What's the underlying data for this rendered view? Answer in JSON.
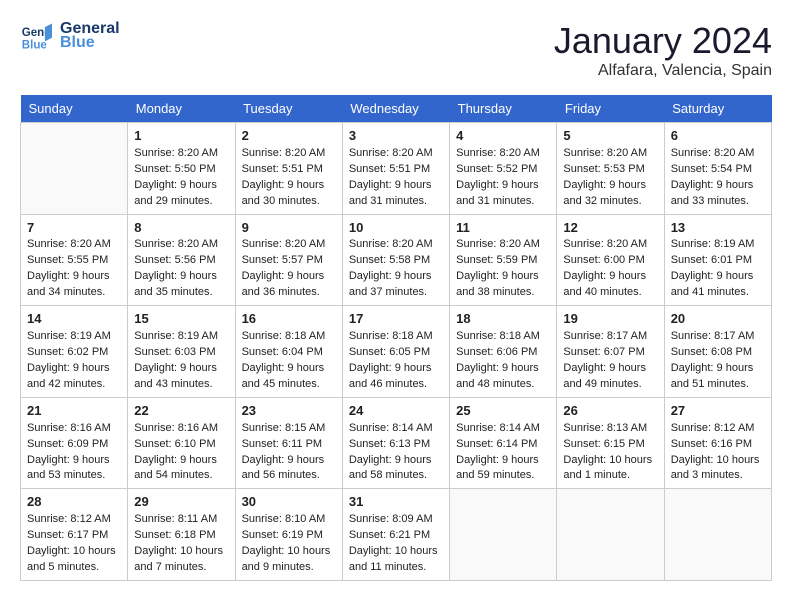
{
  "logo": {
    "line1": "General",
    "line2": "Blue"
  },
  "title": "January 2024",
  "location": "Alfafara, Valencia, Spain",
  "days_of_week": [
    "Sunday",
    "Monday",
    "Tuesday",
    "Wednesday",
    "Thursday",
    "Friday",
    "Saturday"
  ],
  "weeks": [
    [
      {
        "day": "",
        "sunrise": "",
        "sunset": "",
        "daylight": ""
      },
      {
        "day": "1",
        "sunrise": "Sunrise: 8:20 AM",
        "sunset": "Sunset: 5:50 PM",
        "daylight": "Daylight: 9 hours and 29 minutes."
      },
      {
        "day": "2",
        "sunrise": "Sunrise: 8:20 AM",
        "sunset": "Sunset: 5:51 PM",
        "daylight": "Daylight: 9 hours and 30 minutes."
      },
      {
        "day": "3",
        "sunrise": "Sunrise: 8:20 AM",
        "sunset": "Sunset: 5:51 PM",
        "daylight": "Daylight: 9 hours and 31 minutes."
      },
      {
        "day": "4",
        "sunrise": "Sunrise: 8:20 AM",
        "sunset": "Sunset: 5:52 PM",
        "daylight": "Daylight: 9 hours and 31 minutes."
      },
      {
        "day": "5",
        "sunrise": "Sunrise: 8:20 AM",
        "sunset": "Sunset: 5:53 PM",
        "daylight": "Daylight: 9 hours and 32 minutes."
      },
      {
        "day": "6",
        "sunrise": "Sunrise: 8:20 AM",
        "sunset": "Sunset: 5:54 PM",
        "daylight": "Daylight: 9 hours and 33 minutes."
      }
    ],
    [
      {
        "day": "7",
        "sunrise": "Sunrise: 8:20 AM",
        "sunset": "Sunset: 5:55 PM",
        "daylight": "Daylight: 9 hours and 34 minutes."
      },
      {
        "day": "8",
        "sunrise": "Sunrise: 8:20 AM",
        "sunset": "Sunset: 5:56 PM",
        "daylight": "Daylight: 9 hours and 35 minutes."
      },
      {
        "day": "9",
        "sunrise": "Sunrise: 8:20 AM",
        "sunset": "Sunset: 5:57 PM",
        "daylight": "Daylight: 9 hours and 36 minutes."
      },
      {
        "day": "10",
        "sunrise": "Sunrise: 8:20 AM",
        "sunset": "Sunset: 5:58 PM",
        "daylight": "Daylight: 9 hours and 37 minutes."
      },
      {
        "day": "11",
        "sunrise": "Sunrise: 8:20 AM",
        "sunset": "Sunset: 5:59 PM",
        "daylight": "Daylight: 9 hours and 38 minutes."
      },
      {
        "day": "12",
        "sunrise": "Sunrise: 8:20 AM",
        "sunset": "Sunset: 6:00 PM",
        "daylight": "Daylight: 9 hours and 40 minutes."
      },
      {
        "day": "13",
        "sunrise": "Sunrise: 8:19 AM",
        "sunset": "Sunset: 6:01 PM",
        "daylight": "Daylight: 9 hours and 41 minutes."
      }
    ],
    [
      {
        "day": "14",
        "sunrise": "Sunrise: 8:19 AM",
        "sunset": "Sunset: 6:02 PM",
        "daylight": "Daylight: 9 hours and 42 minutes."
      },
      {
        "day": "15",
        "sunrise": "Sunrise: 8:19 AM",
        "sunset": "Sunset: 6:03 PM",
        "daylight": "Daylight: 9 hours and 43 minutes."
      },
      {
        "day": "16",
        "sunrise": "Sunrise: 8:18 AM",
        "sunset": "Sunset: 6:04 PM",
        "daylight": "Daylight: 9 hours and 45 minutes."
      },
      {
        "day": "17",
        "sunrise": "Sunrise: 8:18 AM",
        "sunset": "Sunset: 6:05 PM",
        "daylight": "Daylight: 9 hours and 46 minutes."
      },
      {
        "day": "18",
        "sunrise": "Sunrise: 8:18 AM",
        "sunset": "Sunset: 6:06 PM",
        "daylight": "Daylight: 9 hours and 48 minutes."
      },
      {
        "day": "19",
        "sunrise": "Sunrise: 8:17 AM",
        "sunset": "Sunset: 6:07 PM",
        "daylight": "Daylight: 9 hours and 49 minutes."
      },
      {
        "day": "20",
        "sunrise": "Sunrise: 8:17 AM",
        "sunset": "Sunset: 6:08 PM",
        "daylight": "Daylight: 9 hours and 51 minutes."
      }
    ],
    [
      {
        "day": "21",
        "sunrise": "Sunrise: 8:16 AM",
        "sunset": "Sunset: 6:09 PM",
        "daylight": "Daylight: 9 hours and 53 minutes."
      },
      {
        "day": "22",
        "sunrise": "Sunrise: 8:16 AM",
        "sunset": "Sunset: 6:10 PM",
        "daylight": "Daylight: 9 hours and 54 minutes."
      },
      {
        "day": "23",
        "sunrise": "Sunrise: 8:15 AM",
        "sunset": "Sunset: 6:11 PM",
        "daylight": "Daylight: 9 hours and 56 minutes."
      },
      {
        "day": "24",
        "sunrise": "Sunrise: 8:14 AM",
        "sunset": "Sunset: 6:13 PM",
        "daylight": "Daylight: 9 hours and 58 minutes."
      },
      {
        "day": "25",
        "sunrise": "Sunrise: 8:14 AM",
        "sunset": "Sunset: 6:14 PM",
        "daylight": "Daylight: 9 hours and 59 minutes."
      },
      {
        "day": "26",
        "sunrise": "Sunrise: 8:13 AM",
        "sunset": "Sunset: 6:15 PM",
        "daylight": "Daylight: 10 hours and 1 minute."
      },
      {
        "day": "27",
        "sunrise": "Sunrise: 8:12 AM",
        "sunset": "Sunset: 6:16 PM",
        "daylight": "Daylight: 10 hours and 3 minutes."
      }
    ],
    [
      {
        "day": "28",
        "sunrise": "Sunrise: 8:12 AM",
        "sunset": "Sunset: 6:17 PM",
        "daylight": "Daylight: 10 hours and 5 minutes."
      },
      {
        "day": "29",
        "sunrise": "Sunrise: 8:11 AM",
        "sunset": "Sunset: 6:18 PM",
        "daylight": "Daylight: 10 hours and 7 minutes."
      },
      {
        "day": "30",
        "sunrise": "Sunrise: 8:10 AM",
        "sunset": "Sunset: 6:19 PM",
        "daylight": "Daylight: 10 hours and 9 minutes."
      },
      {
        "day": "31",
        "sunrise": "Sunrise: 8:09 AM",
        "sunset": "Sunset: 6:21 PM",
        "daylight": "Daylight: 10 hours and 11 minutes."
      },
      {
        "day": "",
        "sunrise": "",
        "sunset": "",
        "daylight": ""
      },
      {
        "day": "",
        "sunrise": "",
        "sunset": "",
        "daylight": ""
      },
      {
        "day": "",
        "sunrise": "",
        "sunset": "",
        "daylight": ""
      }
    ]
  ]
}
